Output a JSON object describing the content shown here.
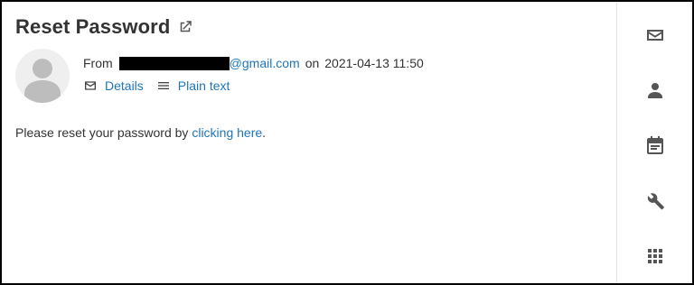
{
  "email": {
    "title": "Reset Password",
    "from_prefix": "From",
    "from_domain": "@gmail.com",
    "on_word": "on",
    "date": "2021-04-13 11:50",
    "actions": {
      "details_label": "Details",
      "plain_label": "Plain text"
    },
    "body": {
      "before": "Please reset your password by",
      "link": "clicking here",
      "after": "."
    }
  },
  "colors": {
    "link": "#1e75bb",
    "text": "#333333",
    "icon": "#555555",
    "avatar_bg": "#efefef",
    "avatar_fg": "#bdbdbd"
  },
  "icons": {
    "title": "external-link-icon",
    "rail": [
      "mail-icon",
      "person-icon",
      "calendar-icon",
      "wrench-icon",
      "apps-grid-icon"
    ]
  }
}
